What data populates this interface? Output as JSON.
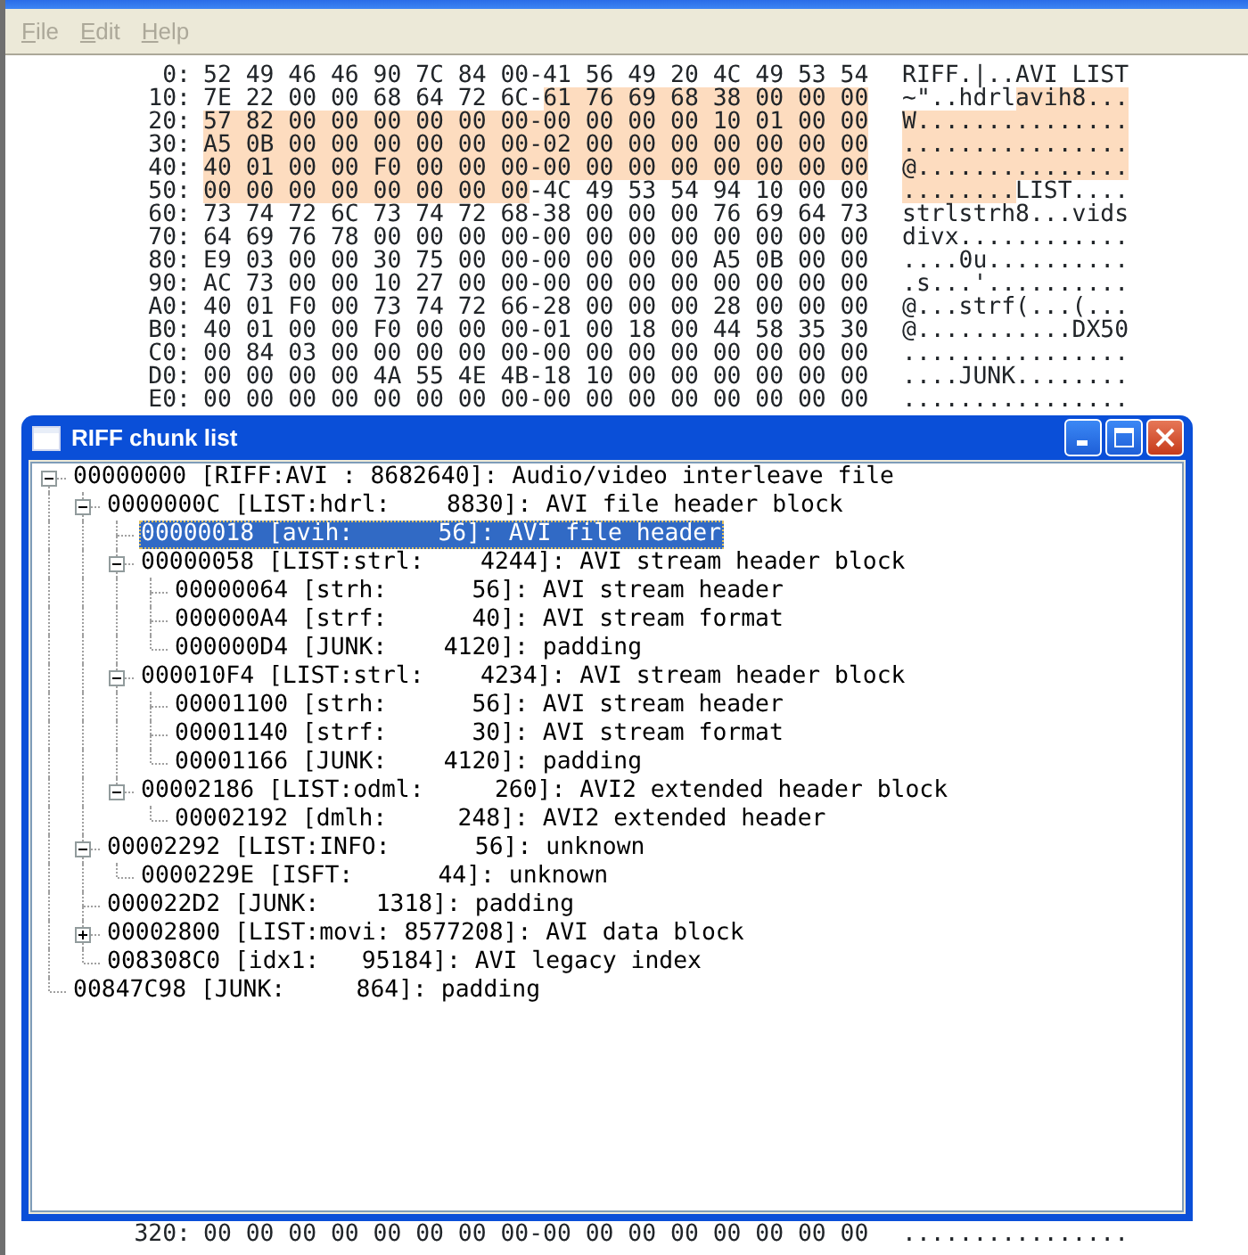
{
  "menu": [
    {
      "label": "File",
      "disabled": true
    },
    {
      "label": "Edit",
      "disabled": true
    },
    {
      "label": "Help",
      "disabled": true
    }
  ],
  "hex_view": {
    "rows": [
      {
        "offset": "0:",
        "hex": [
          {
            "text": "52 49 46 46 90 7C 84 00-41 56 49 20 4C 49 53 54",
            "highlighted": false
          }
        ],
        "ascii": [
          {
            "text": "RIFF.|..AVI LIST",
            "highlighted": false
          }
        ]
      },
      {
        "offset": "10:",
        "hex": [
          {
            "text": "7E 22 00 00 68 64 72 6C-",
            "highlighted": false
          },
          {
            "text": "61 76 69 68 38 00 00 00",
            "highlighted": true
          }
        ],
        "ascii": [
          {
            "text": "~\"..hdrl",
            "highlighted": false
          },
          {
            "text": "avih8...",
            "highlighted": true
          }
        ]
      },
      {
        "offset": "20:",
        "hex": [
          {
            "text": "57 82 00 00 00 00 00 00-00 00 00 00 10 01 00 00",
            "highlighted": true
          }
        ],
        "ascii": [
          {
            "text": "W...............",
            "highlighted": true
          }
        ]
      },
      {
        "offset": "30:",
        "hex": [
          {
            "text": "A5 0B 00 00 00 00 00 00-02 00 00 00 00 00 00 00",
            "highlighted": true
          }
        ],
        "ascii": [
          {
            "text": "................",
            "highlighted": true
          }
        ]
      },
      {
        "offset": "40:",
        "hex": [
          {
            "text": "40 01 00 00 F0 00 00 00-00 00 00 00 00 00 00 00",
            "highlighted": true
          }
        ],
        "ascii": [
          {
            "text": "@...............",
            "highlighted": true
          }
        ]
      },
      {
        "offset": "50:",
        "hex": [
          {
            "text": "00 00 00 00 00 00 00 00",
            "highlighted": true
          },
          {
            "text": "-4C 49 53 54 94 10 00 00",
            "highlighted": false
          }
        ],
        "ascii": [
          {
            "text": "........",
            "highlighted": true
          },
          {
            "text": "LIST....",
            "highlighted": false
          }
        ]
      },
      {
        "offset": "60:",
        "hex": [
          {
            "text": "73 74 72 6C 73 74 72 68-38 00 00 00 76 69 64 73",
            "highlighted": false
          }
        ],
        "ascii": [
          {
            "text": "strlstrh8...vids",
            "highlighted": false
          }
        ]
      },
      {
        "offset": "70:",
        "hex": [
          {
            "text": "64 69 76 78 00 00 00 00-00 00 00 00 00 00 00 00",
            "highlighted": false
          }
        ],
        "ascii": [
          {
            "text": "divx............",
            "highlighted": false
          }
        ]
      },
      {
        "offset": "80:",
        "hex": [
          {
            "text": "E9 03 00 00 30 75 00 00-00 00 00 00 A5 0B 00 00",
            "highlighted": false
          }
        ],
        "ascii": [
          {
            "text": "....0u..........",
            "highlighted": false
          }
        ]
      },
      {
        "offset": "90:",
        "hex": [
          {
            "text": "AC 73 00 00 10 27 00 00-00 00 00 00 00 00 00 00",
            "highlighted": false
          }
        ],
        "ascii": [
          {
            "text": ".s...'..........",
            "highlighted": false
          }
        ]
      },
      {
        "offset": "A0:",
        "hex": [
          {
            "text": "40 01 F0 00 73 74 72 66-28 00 00 00 28 00 00 00",
            "highlighted": false
          }
        ],
        "ascii": [
          {
            "text": "@...strf(...(...",
            "highlighted": false
          }
        ]
      },
      {
        "offset": "B0:",
        "hex": [
          {
            "text": "40 01 00 00 F0 00 00 00-01 00 18 00 44 58 35 30",
            "highlighted": false
          }
        ],
        "ascii": [
          {
            "text": "@...........DX50",
            "highlighted": false
          }
        ]
      },
      {
        "offset": "C0:",
        "hex": [
          {
            "text": "00 84 03 00 00 00 00 00-00 00 00 00 00 00 00 00",
            "highlighted": false
          }
        ],
        "ascii": [
          {
            "text": "................",
            "highlighted": false
          }
        ]
      },
      {
        "offset": "D0:",
        "hex": [
          {
            "text": "00 00 00 00 4A 55 4E 4B-18 10 00 00 00 00 00 00",
            "highlighted": false
          }
        ],
        "ascii": [
          {
            "text": "....JUNK........",
            "highlighted": false
          }
        ]
      },
      {
        "offset": "E0:",
        "hex": [
          {
            "text": "00 00 00 00 00 00 00 00-00 00 00 00 00 00 00 00",
            "highlighted": false
          }
        ],
        "ascii": [
          {
            "text": "................",
            "highlighted": false
          }
        ]
      }
    ],
    "rows_below_window": [
      {
        "offset": "320:",
        "hex": [
          {
            "text": "00 00 00 00 00 00 00 00-00 00 00 00 00 00 00 00",
            "highlighted": false
          }
        ],
        "ascii": [
          {
            "text": "................",
            "highlighted": false
          }
        ]
      }
    ]
  },
  "chunk_window": {
    "title": "RIFF chunk list",
    "tree": [
      {
        "label": "00000000 [RIFF:AVI : 8682640]: Audio/video interleave file",
        "kind": "branch",
        "expanded": true,
        "selected": false,
        "children": [
          {
            "label": "0000000C [LIST:hdrl:    8830]: AVI file header block",
            "kind": "branch",
            "expanded": true,
            "selected": false,
            "children": [
              {
                "label": "00000018 [avih:      56]: AVI file header",
                "kind": "leaf",
                "selected": true
              },
              {
                "label": "00000058 [LIST:strl:    4244]: AVI stream header block",
                "kind": "branch",
                "expanded": true,
                "selected": false,
                "children": [
                  {
                    "label": "00000064 [strh:      56]: AVI stream header",
                    "kind": "leaf",
                    "selected": false
                  },
                  {
                    "label": "000000A4 [strf:      40]: AVI stream format",
                    "kind": "leaf",
                    "selected": false
                  },
                  {
                    "label": "000000D4 [JUNK:    4120]: padding",
                    "kind": "leaf",
                    "selected": false
                  }
                ]
              },
              {
                "label": "000010F4 [LIST:strl:    4234]: AVI stream header block",
                "kind": "branch",
                "expanded": true,
                "selected": false,
                "children": [
                  {
                    "label": "00001100 [strh:      56]: AVI stream header",
                    "kind": "leaf",
                    "selected": false
                  },
                  {
                    "label": "00001140 [strf:      30]: AVI stream format",
                    "kind": "leaf",
                    "selected": false
                  },
                  {
                    "label": "00001166 [JUNK:    4120]: padding",
                    "kind": "leaf",
                    "selected": false
                  }
                ]
              },
              {
                "label": "00002186 [LIST:odml:     260]: AVI2 extended header block",
                "kind": "branch",
                "expanded": true,
                "selected": false,
                "children": [
                  {
                    "label": "00002192 [dmlh:     248]: AVI2 extended header",
                    "kind": "leaf",
                    "selected": false
                  }
                ]
              }
            ]
          },
          {
            "label": "00002292 [LIST:INFO:      56]: unknown",
            "kind": "branch",
            "expanded": true,
            "selected": false,
            "children": [
              {
                "label": "0000229E [ISFT:      44]: unknown",
                "kind": "leaf",
                "selected": false
              }
            ]
          },
          {
            "label": "000022D2 [JUNK:    1318]: padding",
            "kind": "leaf",
            "selected": false
          },
          {
            "label": "00002800 [LIST:movi: 8577208]: AVI data block",
            "kind": "branch",
            "expanded": false,
            "selected": false
          },
          {
            "label": "008308C0 [idx1:   95184]: AVI legacy index",
            "kind": "leaf",
            "selected": false
          }
        ]
      },
      {
        "label": "00847C98 [JUNK:     864]: padding",
        "kind": "leaf",
        "selected": false
      }
    ]
  }
}
